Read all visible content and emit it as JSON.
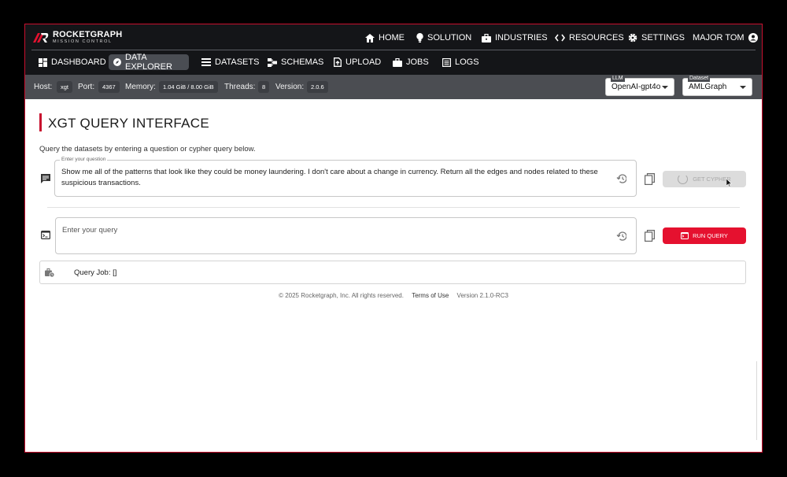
{
  "logo": {
    "brand": "ROCKETGRAPH",
    "sub": "MISSION CONTROL"
  },
  "top_nav": {
    "home": "HOME",
    "solution": "SOLUTION",
    "industries": "INDUSTRIES",
    "resources": "RESOURCES",
    "settings": "SETTINGS",
    "user": "MAJOR TOM"
  },
  "sub_nav": {
    "dashboard": "DASHBOARD",
    "data_explorer": "DATA EXPLORER",
    "datasets": "DATASETS",
    "schemas": "SCHEMAS",
    "upload": "UPLOAD",
    "jobs": "JOBS",
    "logs": "LOGS",
    "active": "data_explorer"
  },
  "status": {
    "host_label": "Host:",
    "host": "xgt",
    "port_label": "Port:",
    "port": "4367",
    "memory_label": "Memory:",
    "memory": "1.04 GiB / 8.00 GiB",
    "threads_label": "Threads:",
    "threads": "8",
    "version_label": "Version:",
    "version": "2.0.6"
  },
  "llm": {
    "label": "LLM",
    "value": "OpenAI-gpt4o"
  },
  "dataset": {
    "label": "Dataset",
    "value": "AMLGraph"
  },
  "main": {
    "title": "XGT QUERY INTERFACE",
    "subtitle": "Query the datasets by entering a question or cypher query below.",
    "question_label": "Enter your question",
    "question_value": "Show me all of the patterns that look like they could be money laundering. I don't care about a change in currency. Return all the edges and nodes related to these suspicious transactions.",
    "get_cypher": "GET CYPHER",
    "query_placeholder": "Enter your query",
    "run_query": "RUN QUERY",
    "job_text": "Query Job: []"
  },
  "footer": {
    "copyright": "© 2025 Rocketgraph, Inc. All rights reserved.",
    "terms": "Terms of Use",
    "version": "Version 2.1.0-RC3"
  },
  "colors": {
    "accent": "#e5112f",
    "header": "#141518",
    "statusbar": "#4b4d52"
  }
}
